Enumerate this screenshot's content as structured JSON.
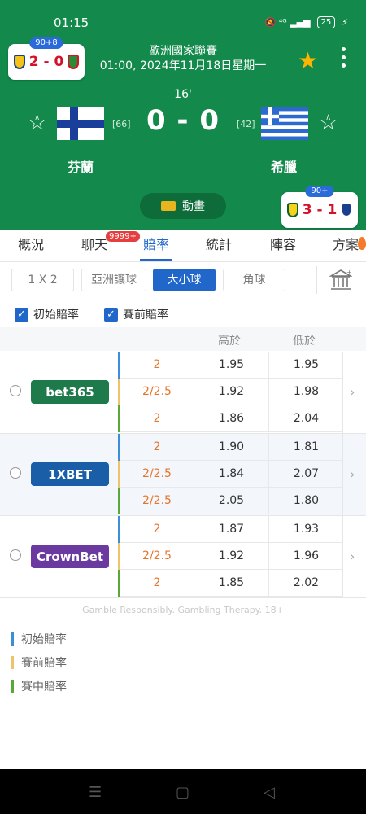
{
  "status": {
    "time": "01:15",
    "icons": "🔕 ⁴ᴳ ▂▄▆",
    "battery": "25"
  },
  "match": {
    "league": "歐洲國家聯賽",
    "datetime": "01:00, 2024年11月18日星期一",
    "minute": "16'",
    "score": "0 - 0",
    "home": {
      "name": "芬蘭",
      "rank": "[66]"
    },
    "away": {
      "name": "希臘",
      "rank": "[42]"
    },
    "animation_label": "動畫"
  },
  "mini_left": {
    "badge": "90+8",
    "score": "2 - 0"
  },
  "mini_right": {
    "badge": "90+",
    "score": "3 - 1"
  },
  "tabs": [
    {
      "label": "概況"
    },
    {
      "label": "聊天",
      "badge": "9999+"
    },
    {
      "label": "賠率"
    },
    {
      "label": "統計"
    },
    {
      "label": "陣容"
    },
    {
      "label": "方案"
    }
  ],
  "markets": [
    {
      "label": "1 X 2"
    },
    {
      "label": "亞洲讓球"
    },
    {
      "label": "大小球"
    },
    {
      "label": "角球"
    }
  ],
  "filters": {
    "initial": "初始賠率",
    "pregame": "賽前賠率"
  },
  "table": {
    "col_over": "高於",
    "col_under": "低於"
  },
  "bookmakers": [
    {
      "name": "bet365",
      "color": "#1e7a4a",
      "rows": [
        {
          "line": "2",
          "over": "1.95",
          "under": "1.95"
        },
        {
          "line": "2/2.5",
          "over": "1.92",
          "under": "1.98"
        },
        {
          "line": "2",
          "over": "1.86",
          "under": "2.04"
        }
      ]
    },
    {
      "name": "1XBET",
      "color": "#1a5ea8",
      "rows": [
        {
          "line": "2",
          "over": "1.90",
          "under": "1.81"
        },
        {
          "line": "2/2.5",
          "over": "1.84",
          "under": "2.07"
        },
        {
          "line": "2/2.5",
          "over": "2.05",
          "under": "1.80"
        }
      ]
    },
    {
      "name": "CrownBet",
      "color": "#6b3aa0",
      "rows": [
        {
          "line": "2",
          "over": "1.87",
          "under": "1.93"
        },
        {
          "line": "2/2.5",
          "over": "1.92",
          "under": "1.96"
        },
        {
          "line": "2",
          "over": "1.85",
          "under": "2.02"
        }
      ]
    }
  ],
  "row_colors": [
    "#3b8fd8",
    "#f0c36a",
    "#5aa83a"
  ],
  "footer_note": "Gamble Responsibly. Gambling Therapy. 18+",
  "legend": [
    {
      "label": "初始賠率",
      "color": "#3b8fd8"
    },
    {
      "label": "賽前賠率",
      "color": "#f0c36a"
    },
    {
      "label": "賽中賠率",
      "color": "#5aa83a"
    }
  ]
}
